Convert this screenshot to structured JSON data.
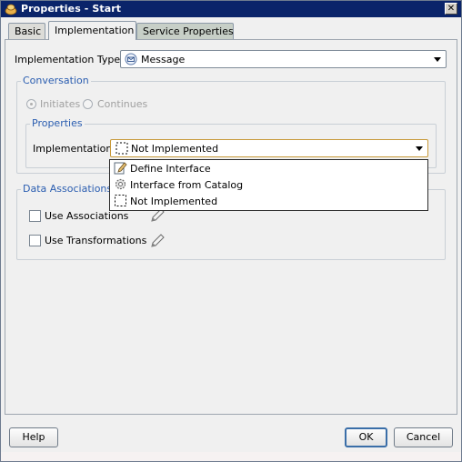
{
  "window": {
    "title": "Properties - Start",
    "close_symbol": "✕"
  },
  "tabs": [
    {
      "label": "Basic"
    },
    {
      "label": "Implementation"
    },
    {
      "label": "Service Properties"
    }
  ],
  "implementation_type": {
    "label": "Implementation Type:",
    "value": "Message"
  },
  "conversation": {
    "title": "Conversation",
    "options": [
      {
        "label": "Initiates",
        "selected": true
      },
      {
        "label": "Continues",
        "selected": false
      }
    ]
  },
  "properties": {
    "title": "Properties",
    "implementation_label": "Implementation:",
    "implementation_value": "Not Implemented"
  },
  "implementation_menu": {
    "items": [
      {
        "label": "Define Interface",
        "icon": "pencil-document-icon"
      },
      {
        "label": "Interface from Catalog",
        "icon": "gear-icon"
      },
      {
        "label": "Not Implemented",
        "icon": "dashed-box-icon"
      }
    ]
  },
  "data_associations": {
    "title": "Data Associations",
    "use_associations_label": "Use Associations",
    "use_transformations_label": "Use Transformations"
  },
  "buttons": {
    "help": "Help",
    "ok": "OK",
    "cancel": "Cancel"
  },
  "colors": {
    "titlebar": "#0a246a",
    "group_title": "#2a5db0"
  }
}
